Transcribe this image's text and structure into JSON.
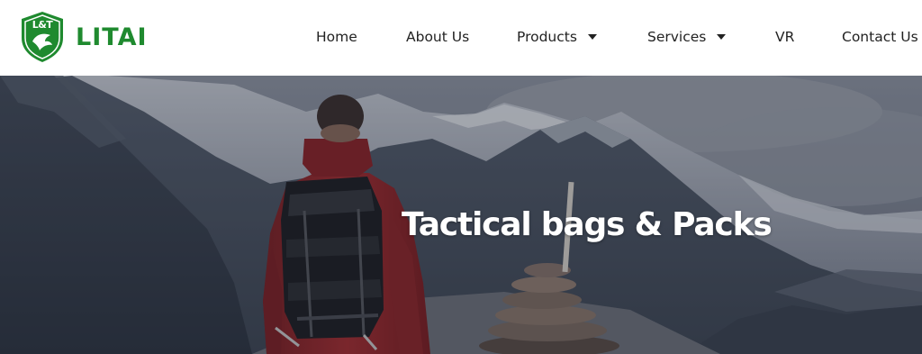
{
  "brand": {
    "badge_text": "L&T",
    "name": "LITAI",
    "color": "#1f8a2f"
  },
  "nav": {
    "items": [
      {
        "label": "Home",
        "has_dropdown": false
      },
      {
        "label": "About Us",
        "has_dropdown": false
      },
      {
        "label": "Products",
        "has_dropdown": true
      },
      {
        "label": "Services",
        "has_dropdown": true
      },
      {
        "label": "VR",
        "has_dropdown": false
      },
      {
        "label": "Contact Us",
        "has_dropdown": false
      }
    ]
  },
  "hero": {
    "title": "Tactical bags & Packs",
    "image": "hiker-with-backpack-mountains"
  }
}
